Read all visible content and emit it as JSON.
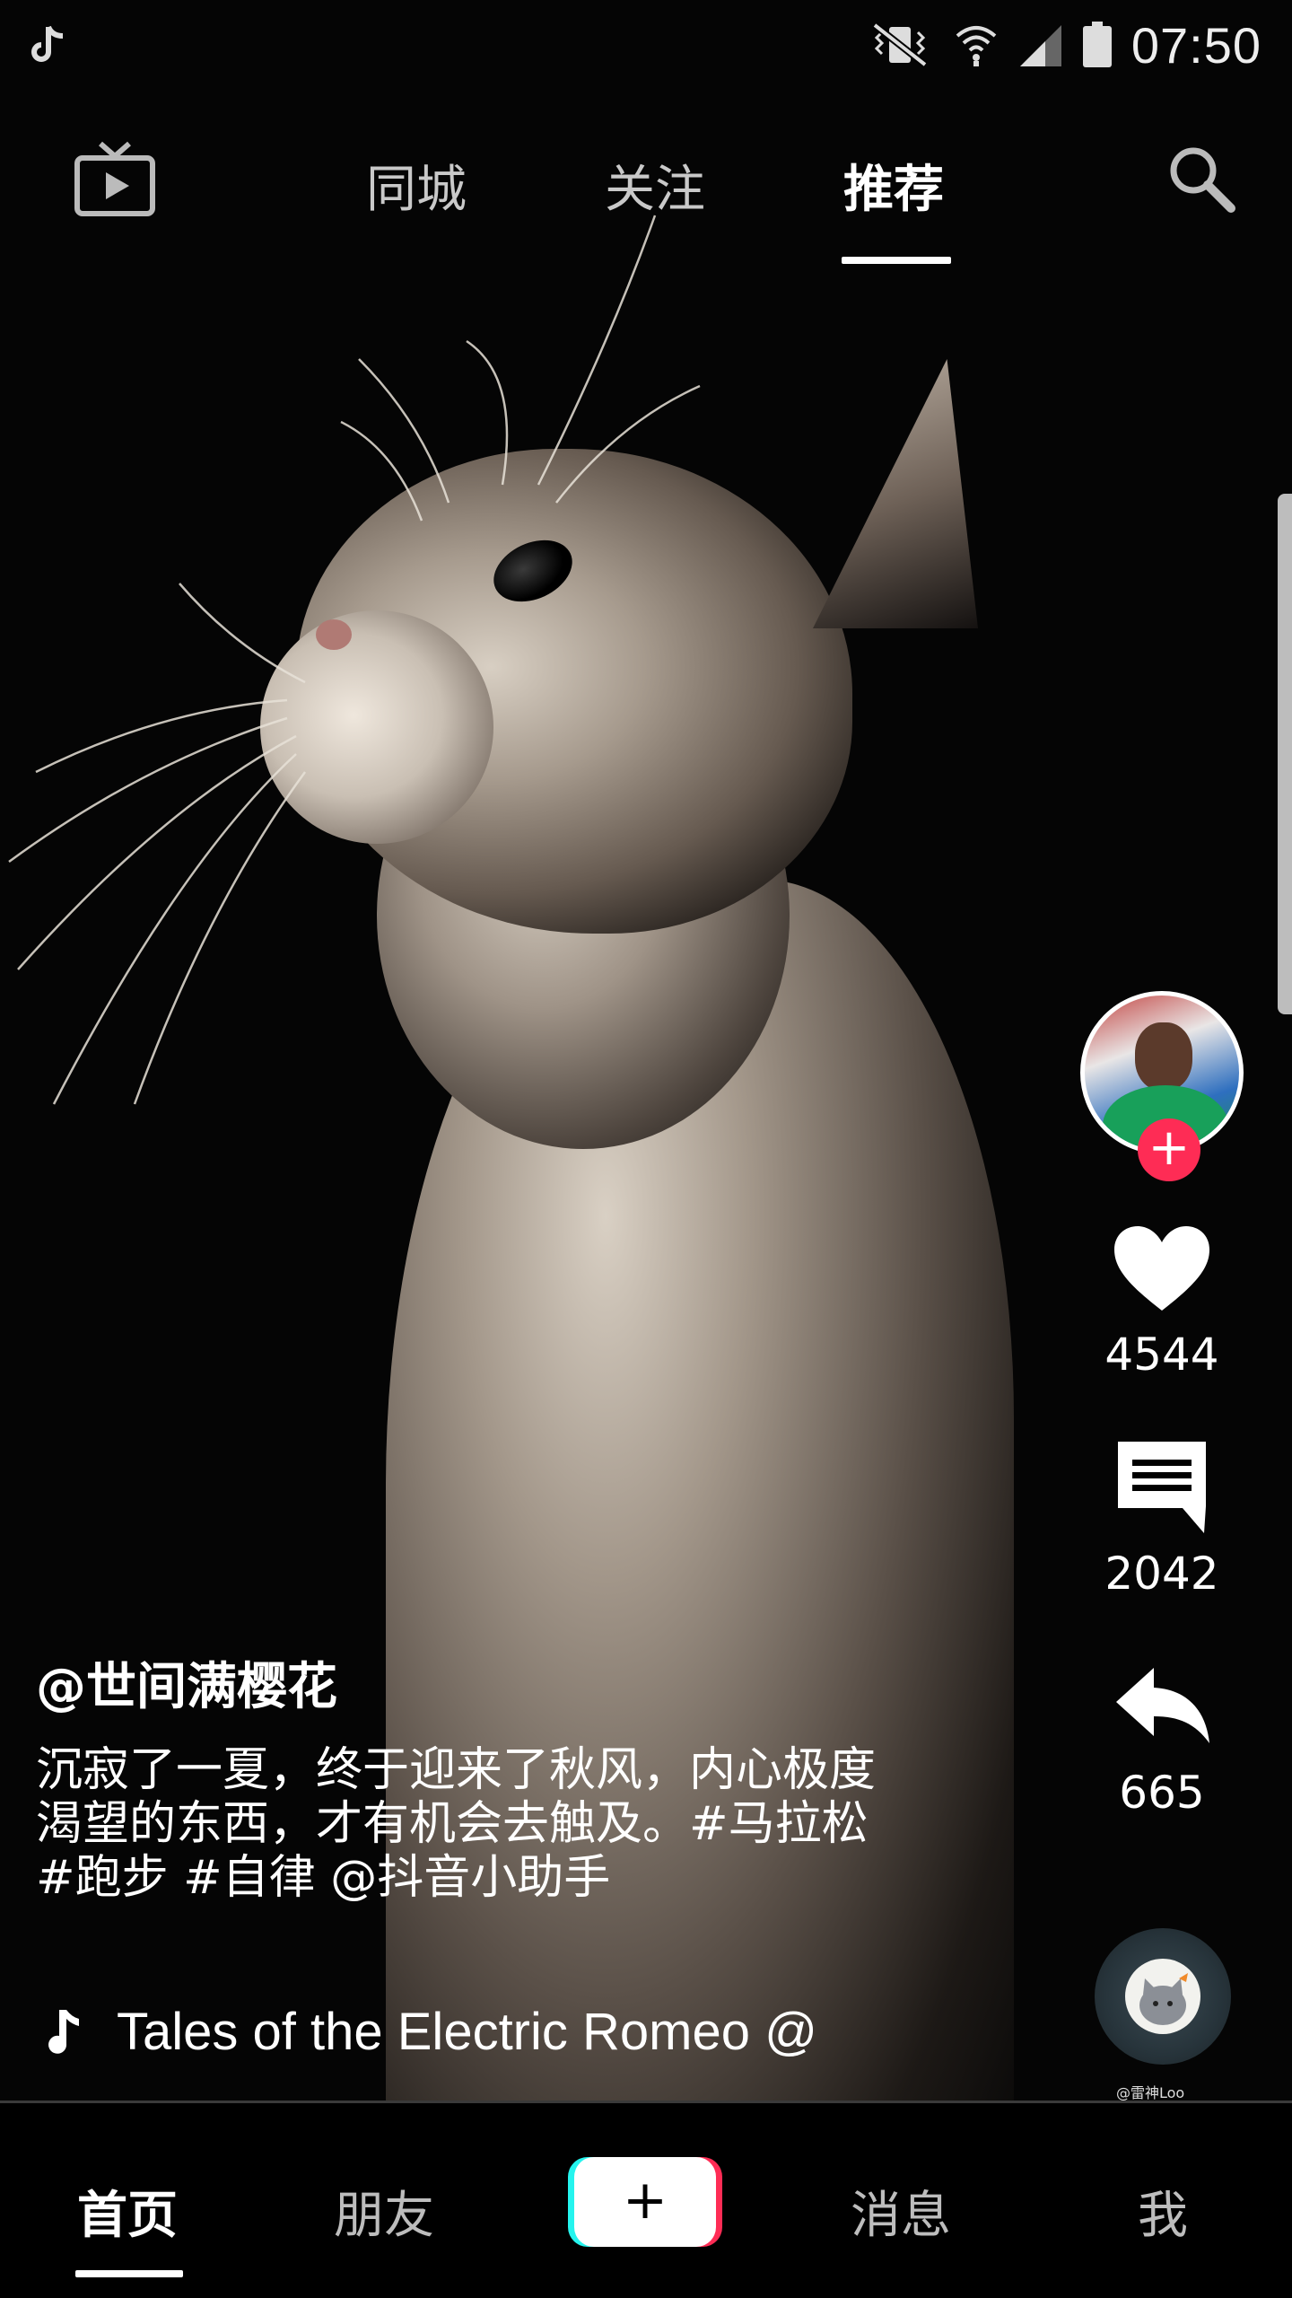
{
  "status_bar": {
    "app_icon": "tiktok-note-icon",
    "icons": [
      "vibrate-mute-icon",
      "wifi-icon",
      "signal-icon",
      "battery-icon"
    ],
    "time": "07:50"
  },
  "top_nav": {
    "live_icon": "tv-icon",
    "tabs": [
      {
        "label": "同城",
        "active": false
      },
      {
        "label": "关注",
        "active": false
      },
      {
        "label": "推荐",
        "active": true
      }
    ],
    "search_icon": "search-icon"
  },
  "video": {
    "author": "@世间满樱花",
    "caption": "沉寂了一夏，终于迎来了秋风，内心极度渴望的东西，才有机会去触及。#马拉松 #跑步 #自律 @抖音小助手",
    "music": "Tales of the Electric Romeo @",
    "watermark": "@雷神Loo"
  },
  "actions": {
    "follow_symbol": "+",
    "likes": "4544",
    "comments": "2042",
    "shares": "665"
  },
  "bottom_nav": {
    "home": "首页",
    "friends": "朋友",
    "create": "+",
    "messages": "消息",
    "me": "我"
  },
  "colors": {
    "accent_red": "#fe2c55",
    "accent_cyan": "#25f4ee",
    "background": "#000000"
  }
}
